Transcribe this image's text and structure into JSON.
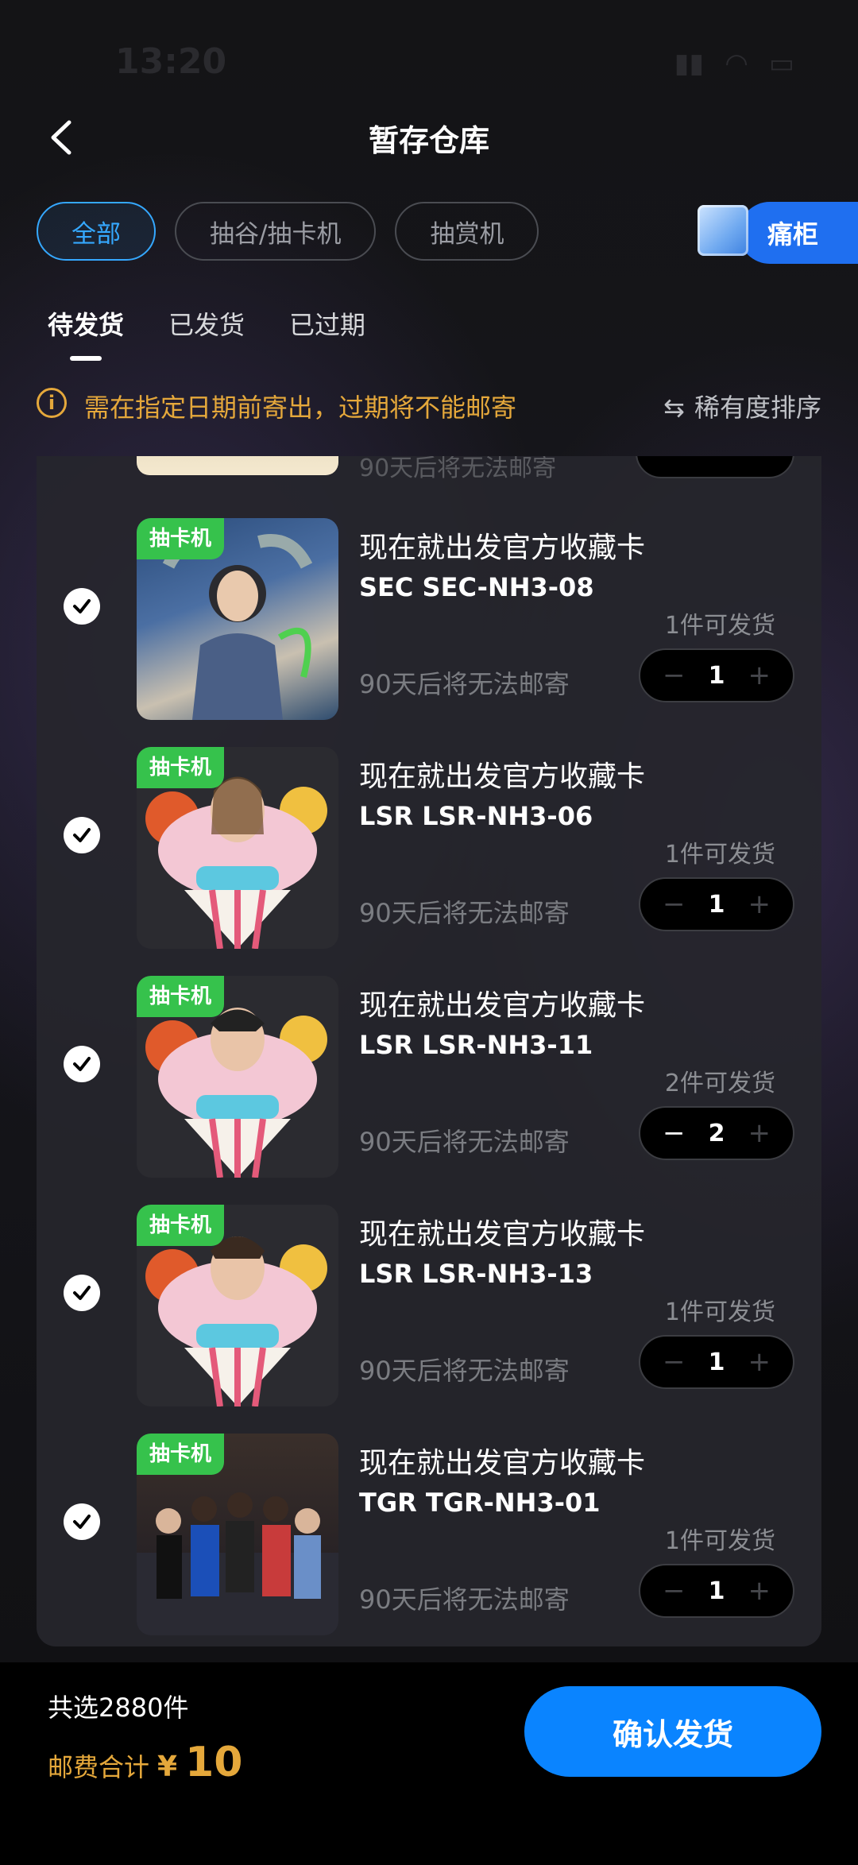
{
  "status": {
    "time": "13:20"
  },
  "nav": {
    "title": "暂存仓库"
  },
  "filters": [
    {
      "label": "全部",
      "active": true
    },
    {
      "label": "抽谷/抽卡机",
      "active": false
    },
    {
      "label": "抽赏机",
      "active": false
    }
  ],
  "cabinet": {
    "label": "痛柜"
  },
  "tabs": [
    {
      "label": "待发货",
      "active": true
    },
    {
      "label": "已发货",
      "active": false
    },
    {
      "label": "已过期",
      "active": false
    }
  ],
  "notice": {
    "text": "需在指定日期前寄出，过期将不能邮寄",
    "sort_label": "稀有度排序"
  },
  "partial": {
    "text": "90天后将无法邮寄"
  },
  "items": [
    {
      "tag": "抽卡机",
      "name": "现在就出发官方收藏卡",
      "code": "SEC SEC-NH3-08",
      "available": "1件可发货",
      "expiry": "90天后将无法邮寄",
      "qty": "1"
    },
    {
      "tag": "抽卡机",
      "name": "现在就出发官方收藏卡",
      "code": "LSR LSR-NH3-06",
      "available": "1件可发货",
      "expiry": "90天后将无法邮寄",
      "qty": "1"
    },
    {
      "tag": "抽卡机",
      "name": "现在就出发官方收藏卡",
      "code": "LSR LSR-NH3-11",
      "available": "2件可发货",
      "expiry": "90天后将无法邮寄",
      "qty": "2"
    },
    {
      "tag": "抽卡机",
      "name": "现在就出发官方收藏卡",
      "code": "LSR LSR-NH3-13",
      "available": "1件可发货",
      "expiry": "90天后将无法邮寄",
      "qty": "1"
    },
    {
      "tag": "抽卡机",
      "name": "现在就出发官方收藏卡",
      "code": "TGR TGR-NH3-01",
      "available": "1件可发货",
      "expiry": "90天后将无法邮寄",
      "qty": "1"
    }
  ],
  "footer": {
    "count": "共选2880件",
    "fee_label": "邮费合计",
    "currency": "¥",
    "amount": "10",
    "confirm": "确认发货"
  },
  "colors": {
    "accent": "#0a84ff",
    "warning": "#e5a83b",
    "tag": "#36c24c"
  }
}
